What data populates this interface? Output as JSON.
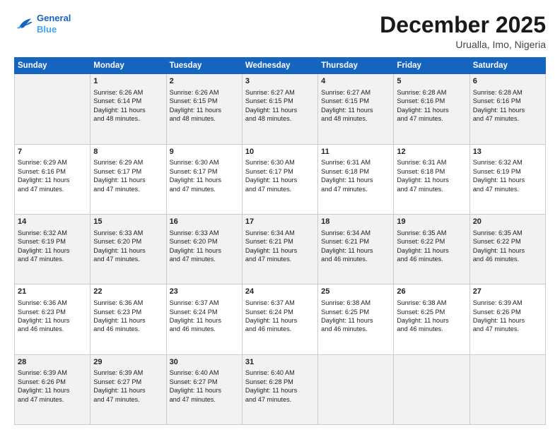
{
  "header": {
    "logo_line1": "General",
    "logo_line2": "Blue",
    "month": "December 2025",
    "location": "Urualla, Imo, Nigeria"
  },
  "weekdays": [
    "Sunday",
    "Monday",
    "Tuesday",
    "Wednesday",
    "Thursday",
    "Friday",
    "Saturday"
  ],
  "rows": [
    [
      {
        "day": "",
        "info": ""
      },
      {
        "day": "1",
        "info": "Sunrise: 6:26 AM\nSunset: 6:14 PM\nDaylight: 11 hours\nand 48 minutes."
      },
      {
        "day": "2",
        "info": "Sunrise: 6:26 AM\nSunset: 6:15 PM\nDaylight: 11 hours\nand 48 minutes."
      },
      {
        "day": "3",
        "info": "Sunrise: 6:27 AM\nSunset: 6:15 PM\nDaylight: 11 hours\nand 48 minutes."
      },
      {
        "day": "4",
        "info": "Sunrise: 6:27 AM\nSunset: 6:15 PM\nDaylight: 11 hours\nand 48 minutes."
      },
      {
        "day": "5",
        "info": "Sunrise: 6:28 AM\nSunset: 6:16 PM\nDaylight: 11 hours\nand 47 minutes."
      },
      {
        "day": "6",
        "info": "Sunrise: 6:28 AM\nSunset: 6:16 PM\nDaylight: 11 hours\nand 47 minutes."
      }
    ],
    [
      {
        "day": "7",
        "info": "Sunrise: 6:29 AM\nSunset: 6:16 PM\nDaylight: 11 hours\nand 47 minutes."
      },
      {
        "day": "8",
        "info": "Sunrise: 6:29 AM\nSunset: 6:17 PM\nDaylight: 11 hours\nand 47 minutes."
      },
      {
        "day": "9",
        "info": "Sunrise: 6:30 AM\nSunset: 6:17 PM\nDaylight: 11 hours\nand 47 minutes."
      },
      {
        "day": "10",
        "info": "Sunrise: 6:30 AM\nSunset: 6:17 PM\nDaylight: 11 hours\nand 47 minutes."
      },
      {
        "day": "11",
        "info": "Sunrise: 6:31 AM\nSunset: 6:18 PM\nDaylight: 11 hours\nand 47 minutes."
      },
      {
        "day": "12",
        "info": "Sunrise: 6:31 AM\nSunset: 6:18 PM\nDaylight: 11 hours\nand 47 minutes."
      },
      {
        "day": "13",
        "info": "Sunrise: 6:32 AM\nSunset: 6:19 PM\nDaylight: 11 hours\nand 47 minutes."
      }
    ],
    [
      {
        "day": "14",
        "info": "Sunrise: 6:32 AM\nSunset: 6:19 PM\nDaylight: 11 hours\nand 47 minutes."
      },
      {
        "day": "15",
        "info": "Sunrise: 6:33 AM\nSunset: 6:20 PM\nDaylight: 11 hours\nand 47 minutes."
      },
      {
        "day": "16",
        "info": "Sunrise: 6:33 AM\nSunset: 6:20 PM\nDaylight: 11 hours\nand 47 minutes."
      },
      {
        "day": "17",
        "info": "Sunrise: 6:34 AM\nSunset: 6:21 PM\nDaylight: 11 hours\nand 47 minutes."
      },
      {
        "day": "18",
        "info": "Sunrise: 6:34 AM\nSunset: 6:21 PM\nDaylight: 11 hours\nand 46 minutes."
      },
      {
        "day": "19",
        "info": "Sunrise: 6:35 AM\nSunset: 6:22 PM\nDaylight: 11 hours\nand 46 minutes."
      },
      {
        "day": "20",
        "info": "Sunrise: 6:35 AM\nSunset: 6:22 PM\nDaylight: 11 hours\nand 46 minutes."
      }
    ],
    [
      {
        "day": "21",
        "info": "Sunrise: 6:36 AM\nSunset: 6:23 PM\nDaylight: 11 hours\nand 46 minutes."
      },
      {
        "day": "22",
        "info": "Sunrise: 6:36 AM\nSunset: 6:23 PM\nDaylight: 11 hours\nand 46 minutes."
      },
      {
        "day": "23",
        "info": "Sunrise: 6:37 AM\nSunset: 6:24 PM\nDaylight: 11 hours\nand 46 minutes."
      },
      {
        "day": "24",
        "info": "Sunrise: 6:37 AM\nSunset: 6:24 PM\nDaylight: 11 hours\nand 46 minutes."
      },
      {
        "day": "25",
        "info": "Sunrise: 6:38 AM\nSunset: 6:25 PM\nDaylight: 11 hours\nand 46 minutes."
      },
      {
        "day": "26",
        "info": "Sunrise: 6:38 AM\nSunset: 6:25 PM\nDaylight: 11 hours\nand 46 minutes."
      },
      {
        "day": "27",
        "info": "Sunrise: 6:39 AM\nSunset: 6:26 PM\nDaylight: 11 hours\nand 47 minutes."
      }
    ],
    [
      {
        "day": "28",
        "info": "Sunrise: 6:39 AM\nSunset: 6:26 PM\nDaylight: 11 hours\nand 47 minutes."
      },
      {
        "day": "29",
        "info": "Sunrise: 6:39 AM\nSunset: 6:27 PM\nDaylight: 11 hours\nand 47 minutes."
      },
      {
        "day": "30",
        "info": "Sunrise: 6:40 AM\nSunset: 6:27 PM\nDaylight: 11 hours\nand 47 minutes."
      },
      {
        "day": "31",
        "info": "Sunrise: 6:40 AM\nSunset: 6:28 PM\nDaylight: 11 hours\nand 47 minutes."
      },
      {
        "day": "",
        "info": ""
      },
      {
        "day": "",
        "info": ""
      },
      {
        "day": "",
        "info": ""
      }
    ]
  ]
}
